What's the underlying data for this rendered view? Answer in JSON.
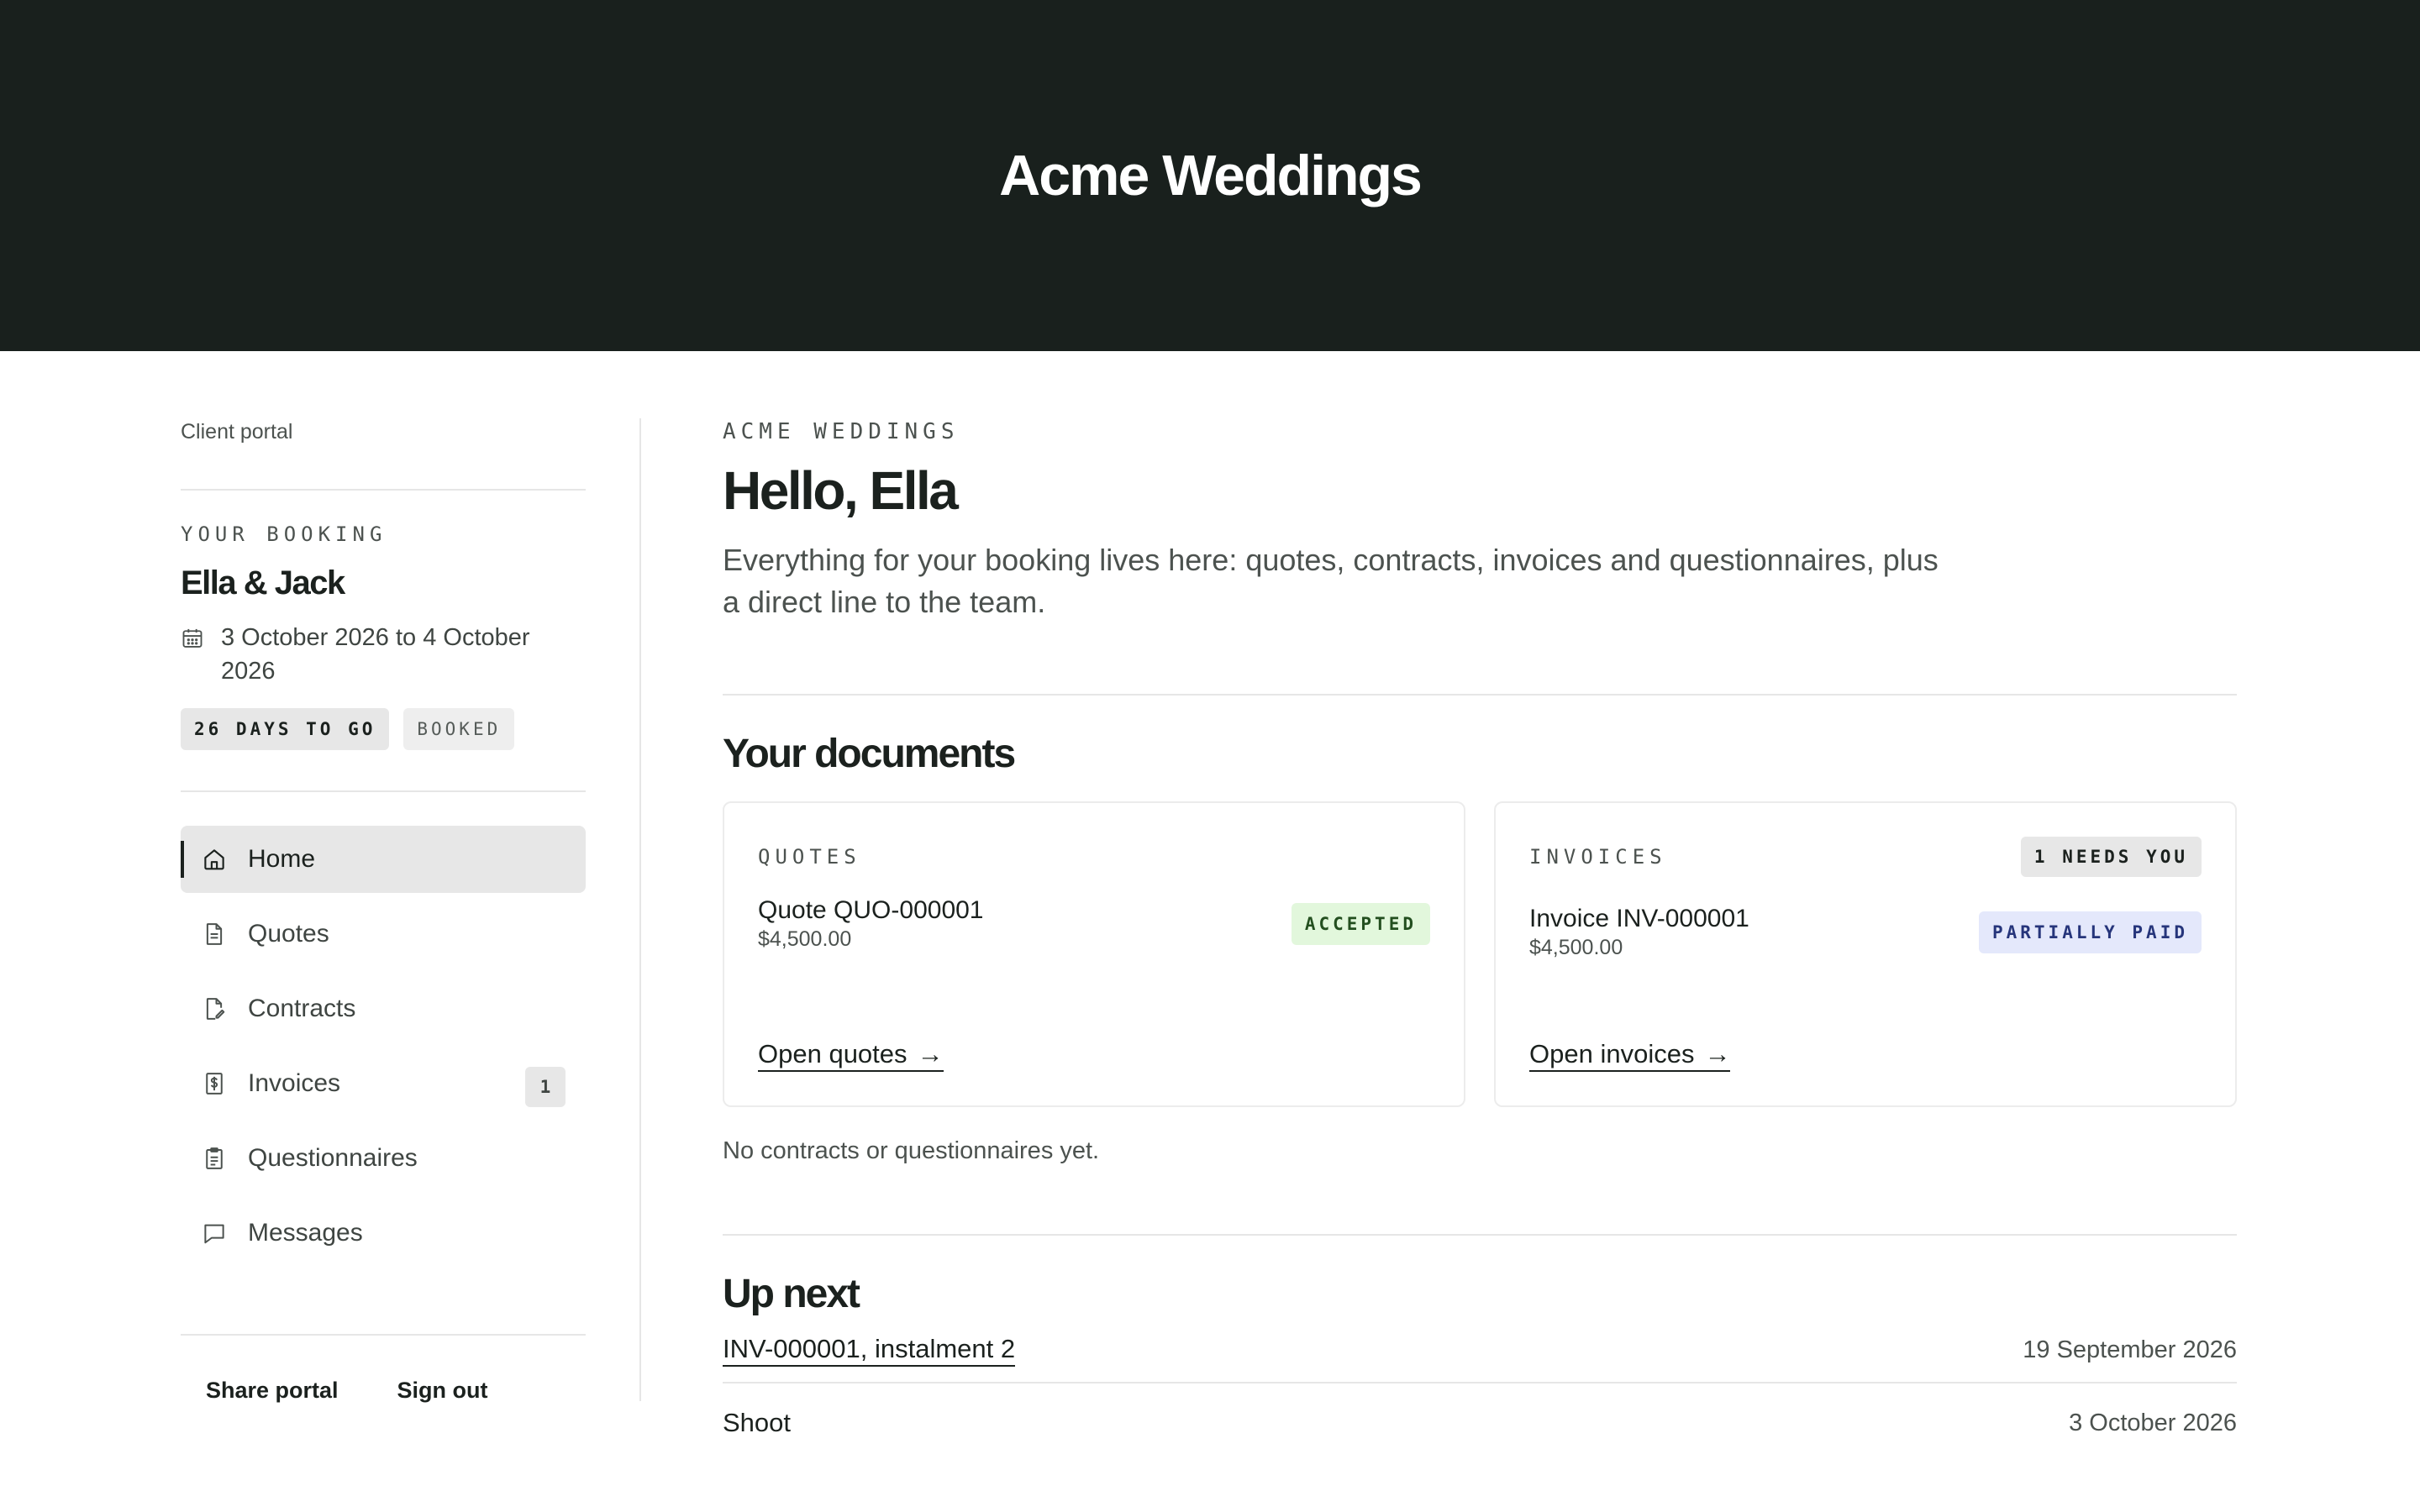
{
  "header": {
    "title": "Acme Weddings"
  },
  "sidebar": {
    "portal_label": "Client portal",
    "booking_eyebrow": "YOUR BOOKING",
    "booking_name": "Ella & Jack",
    "booking_dates": "3 October 2026 to 4 October 2026",
    "countdown_badge": "26 DAYS TO GO",
    "status_badge": "BOOKED",
    "nav": [
      {
        "label": "Home",
        "icon": "home-icon",
        "active": true
      },
      {
        "label": "Quotes",
        "icon": "document-icon"
      },
      {
        "label": "Contracts",
        "icon": "contract-edit-icon"
      },
      {
        "label": "Invoices",
        "icon": "invoice-dollar-icon",
        "count": "1"
      },
      {
        "label": "Questionnaires",
        "icon": "clipboard-icon"
      },
      {
        "label": "Messages",
        "icon": "message-icon"
      }
    ],
    "share_label": "Share portal",
    "signout_label": "Sign out"
  },
  "main": {
    "eyebrow": "ACME WEDDINGS",
    "greeting": "Hello, Ella",
    "intro": "Everything for your booking lives here: quotes, contracts, invoices and questionnaires, plus a direct line to the team.",
    "documents_title": "Your documents",
    "quotes_card": {
      "eyebrow": "QUOTES",
      "name": "Quote QUO-000001",
      "amount": "$4,500.00",
      "status": "ACCEPTED",
      "link": "Open quotes",
      "arrow": "→"
    },
    "invoices_card": {
      "eyebrow": "INVOICES",
      "needs_badge": "1 NEEDS YOU",
      "name": "Invoice INV-000001",
      "amount": "$4,500.00",
      "status": "PARTIALLY PAID",
      "link": "Open invoices",
      "arrow": "→"
    },
    "empty_note": "No contracts or questionnaires yet.",
    "upnext_title": "Up next",
    "upnext": [
      {
        "label": "INV-000001, instalment 2",
        "date": "19 September 2026"
      },
      {
        "label": "Shoot",
        "date": "3 October 2026"
      }
    ]
  },
  "colors": {
    "header_bg": "#19201d",
    "accepted_bg": "#e2f7dc",
    "partial_bg": "#e4e8fb",
    "active_nav_bg": "#e7e7e7"
  }
}
